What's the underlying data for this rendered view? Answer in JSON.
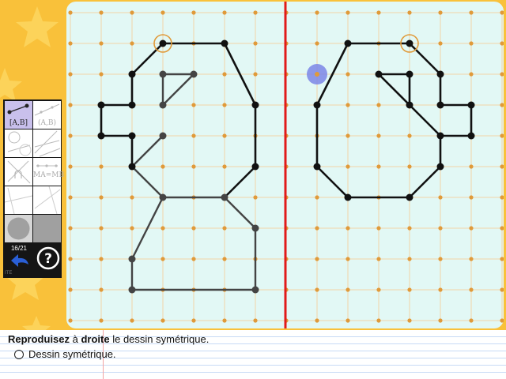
{
  "instruction": {
    "part1": "Reproduisez",
    "part2": " à ",
    "part3": "droite",
    "part4": " le dessin symétrique."
  },
  "option": {
    "label": "Dessin symétrique."
  },
  "toolbox": {
    "tool_segment_active": "[A,B]",
    "tool_segment_grey": "(A,B)",
    "tool_midpoint": "MA=MB",
    "page_counter": "16/21",
    "credit": "ITE"
  },
  "icons": {
    "back": "back-arrow-icon",
    "help": "question-mark-icon"
  },
  "colors": {
    "axis": "#e11a1a",
    "highlight": "#7b86e6",
    "node": "#e09a3a",
    "figure": "#111111"
  }
}
